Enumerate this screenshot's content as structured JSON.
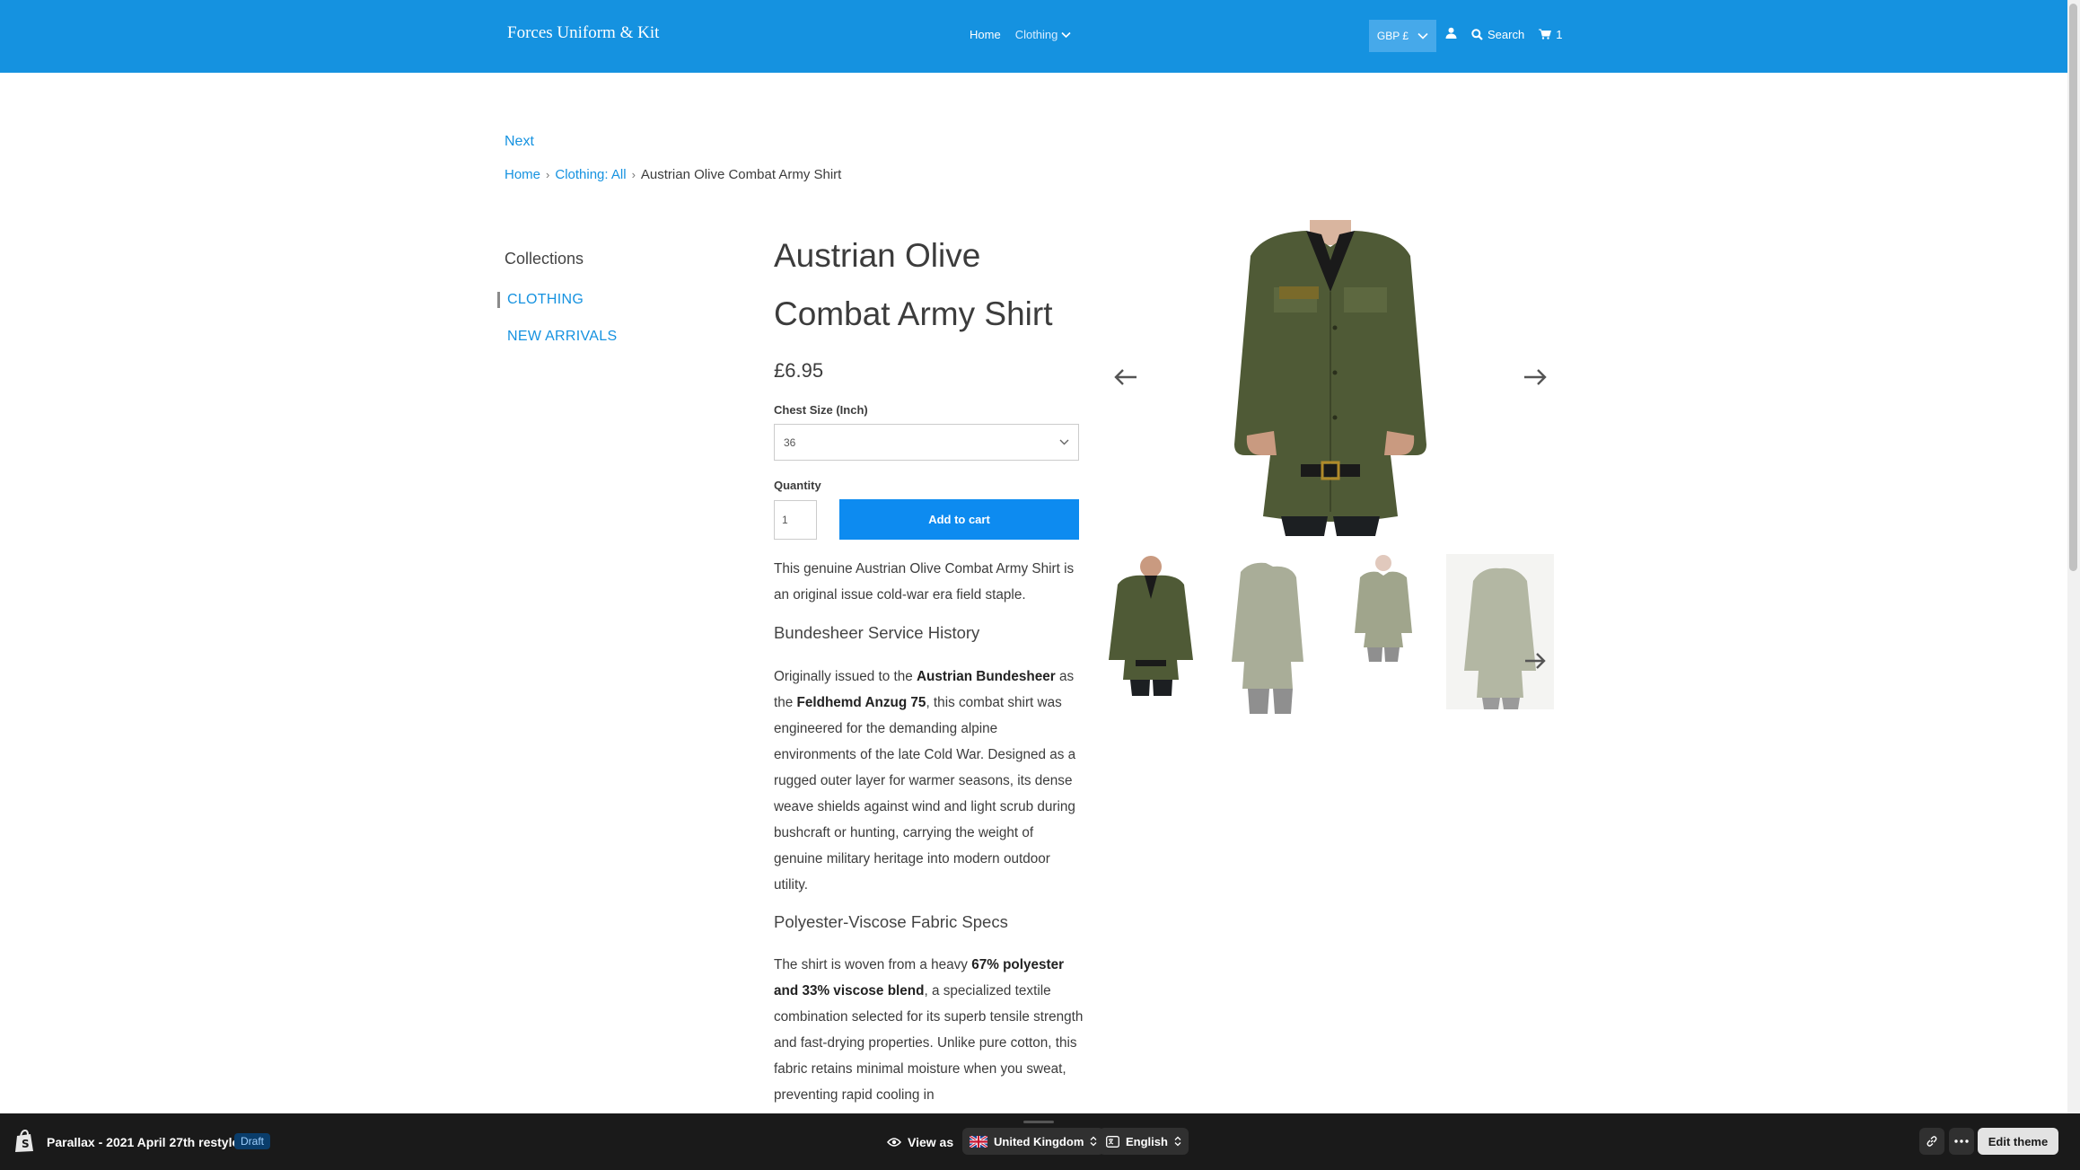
{
  "header": {
    "logo": "Forces Uniform & Kit",
    "nav": {
      "home": "Home",
      "clothing": "Clothing"
    },
    "currency": "GBP £",
    "search_label": "Search",
    "cart_count": "1",
    "colors": {
      "bar": "#1592e0"
    }
  },
  "page": {
    "next_link": "Next",
    "breadcrumb": {
      "home": "Home",
      "category": "Clothing: All",
      "current": "Austrian Olive Combat Army Shirt"
    }
  },
  "sidebar": {
    "title": "Collections",
    "items": [
      {
        "label": "CLOTHING",
        "active": true
      },
      {
        "label": "NEW ARRIVALS",
        "active": false
      }
    ]
  },
  "product": {
    "title_line1": "Austrian Olive",
    "title_line2": "Combat Army Shirt",
    "price": "£6.95",
    "size_label": "Chest Size (Inch)",
    "size_value": "36",
    "quantity_label": "Quantity",
    "quantity_value": "1",
    "add_to_cart": "Add to cart",
    "intro": "This genuine Austrian Olive Combat Army Shirt is an original issue cold-war era field staple.",
    "section1_heading": "Bundesheer Service History",
    "section1": {
      "p1": "Originally issued to the ",
      "b1": "Austrian Bundesheer",
      "p2": " as the ",
      "b2": "Feldhemd Anzug 75",
      "p3": ", this combat shirt was engineered for the demanding alpine environments of the late Cold War. Designed as a rugged outer layer for warmer seasons, its dense weave shields against wind and light scrub during bushcraft or hunting, carrying the weight of genuine military heritage into modern outdoor utility."
    },
    "section2_heading": "Polyester-Viscose Fabric Specs",
    "section2": {
      "p1": "The shirt is woven from a heavy ",
      "b1": "67% polyester and 33% viscose blend",
      "p2": ", a specialized textile combination selected for its superb tensile strength and fast-drying properties. Unlike pure cotton, this fabric retains minimal moisture when you sweat, preventing rapid cooling in"
    },
    "olive_color": "#4f5a36"
  },
  "editor_bar": {
    "theme_name": "Parallax - 2021 April 27th restyle",
    "status": "Draft",
    "view_as": "View as",
    "country": "United Kingdom",
    "language": "English",
    "edit_theme": "Edit theme"
  }
}
